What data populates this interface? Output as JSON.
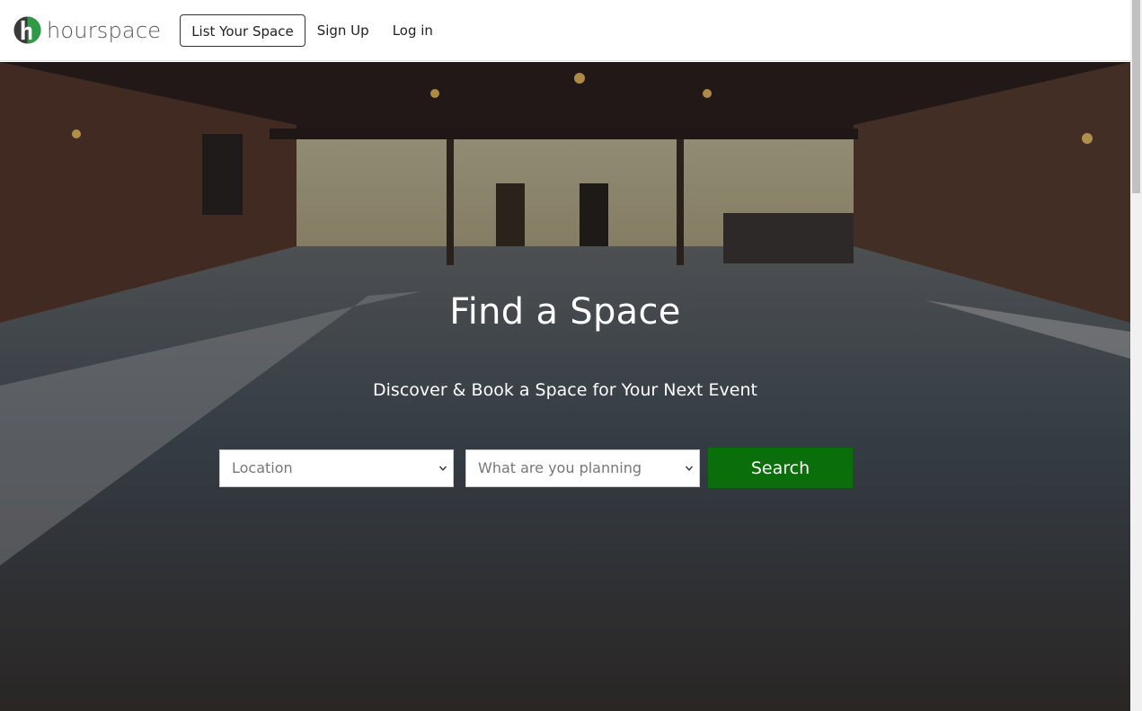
{
  "nav": {
    "brand": "hourspace",
    "list_space": "List Your Space",
    "sign_up": "Sign Up",
    "log_in": "Log in"
  },
  "hero": {
    "title": "Find a Space",
    "subtitle": "Discover & Book a Space for Your Next Event"
  },
  "search": {
    "location_selected": "Location",
    "planning_selected": "What are you planning",
    "button": "Search"
  },
  "colors": {
    "brand_dark": "#3a3a3a",
    "brand_green": "#2e9a46",
    "search_button": "#0a6e0a"
  },
  "icons": [
    "hourspace-logo-icon",
    "chevron-down-icon"
  ]
}
